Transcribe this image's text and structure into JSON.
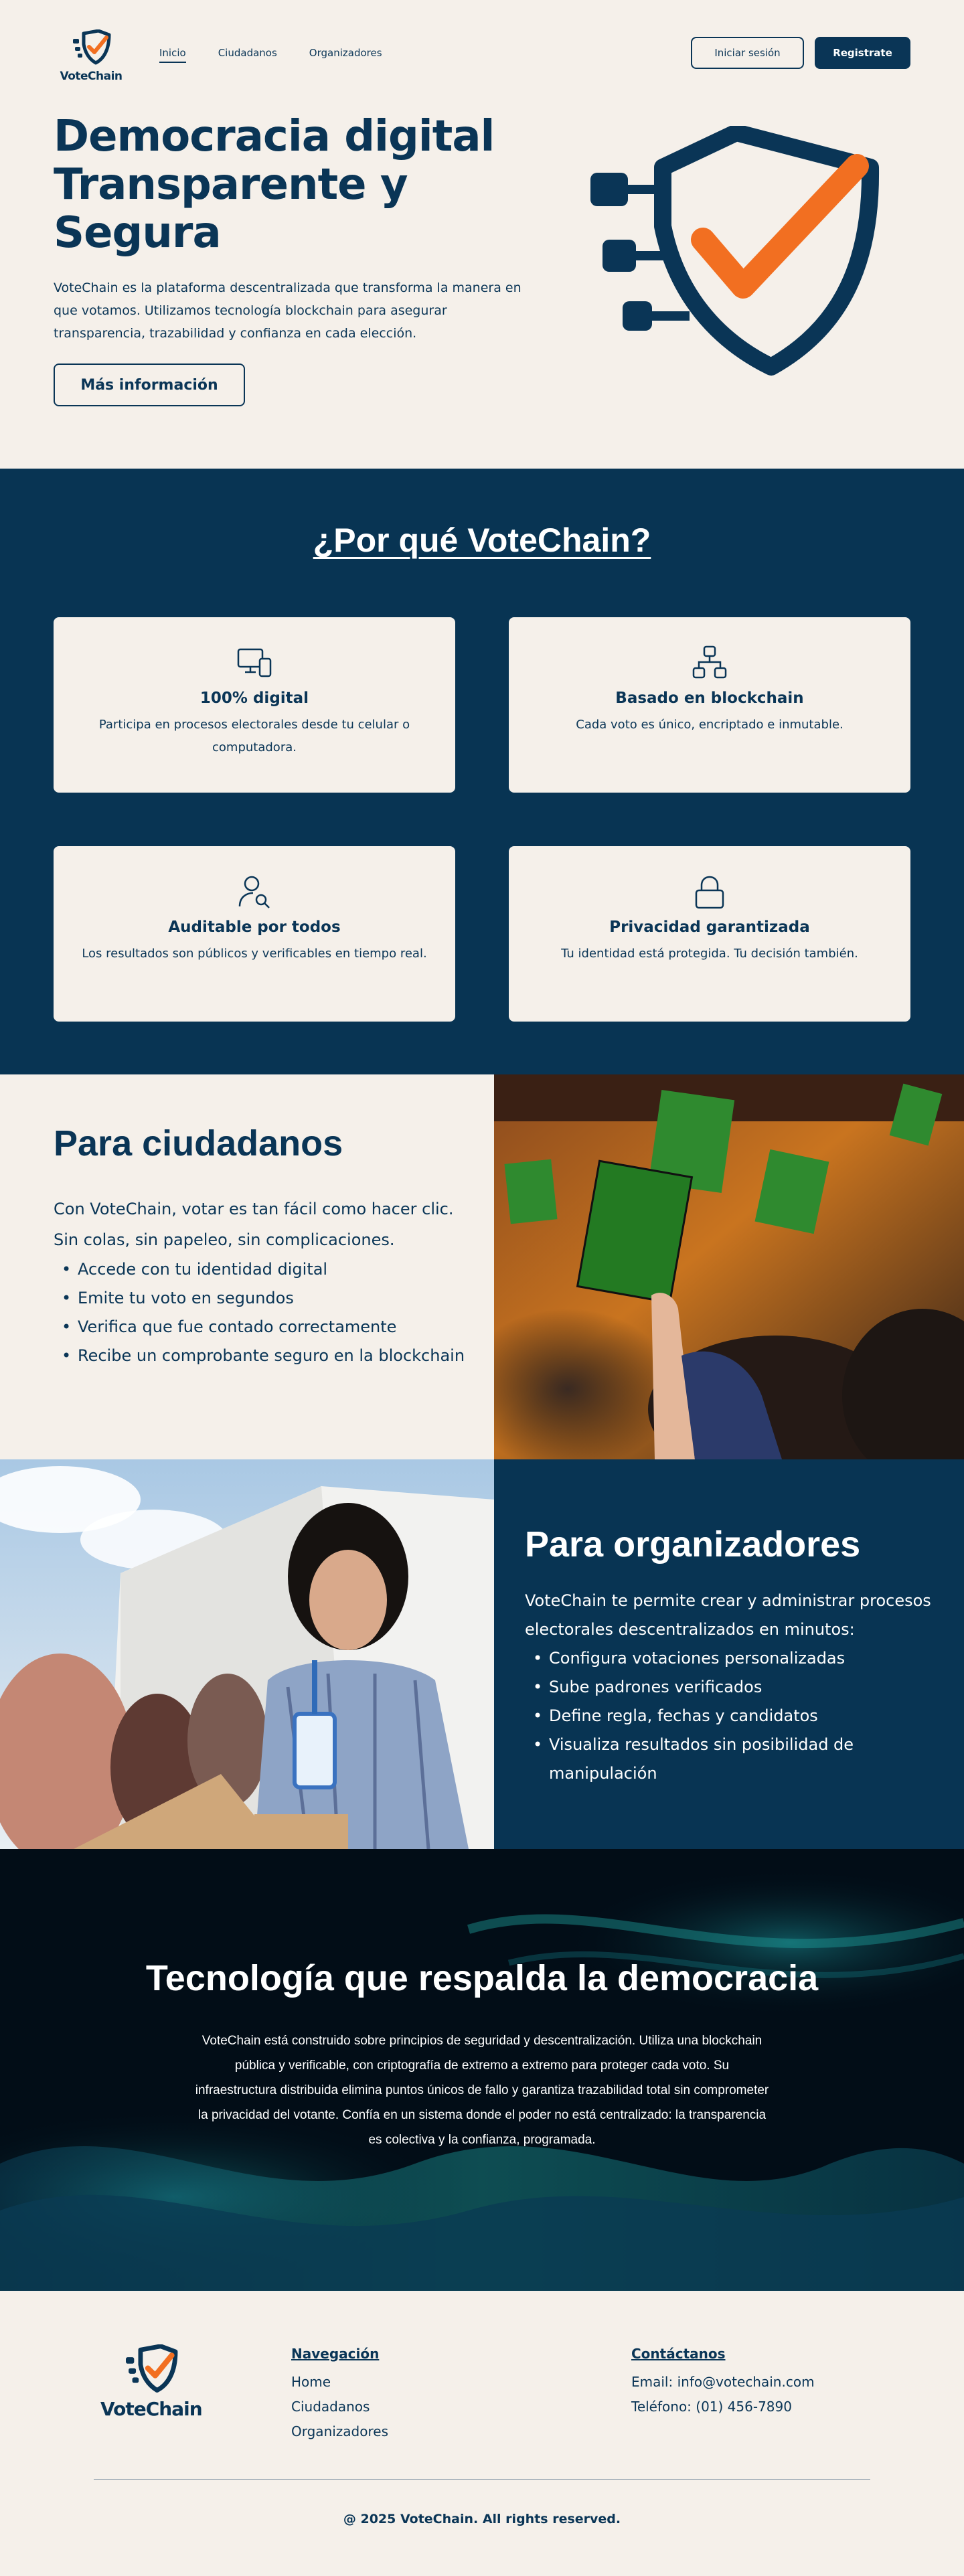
{
  "brand": {
    "name": "VoteChain",
    "colors": {
      "navy": "#0a3556",
      "orange": "#f26f21",
      "cream": "#f5f0ea"
    }
  },
  "nav": {
    "links": [
      "Inicio",
      "Ciudadanos",
      "Organizadores"
    ],
    "active": "Inicio",
    "login_label": "Iniciar sesión",
    "register_label": "Registrate"
  },
  "hero": {
    "title_line1": "Democracia digital",
    "title_line2": "Transparente y",
    "title_line3": "Segura",
    "description": "VoteChain es la plataforma descentralizada que transforma la manera en que votamos. Utilizamos tecnología blockchain para asegurar transparencia, trazabilidad y confianza en cada elección.",
    "cta_label": "Más información",
    "icon": "shield-check-icon"
  },
  "why": {
    "title": "¿Por qué VoteChain?",
    "cards": [
      {
        "icon": "devices-icon",
        "title": "100% digital",
        "description": "Participa en procesos electorales desde tu celular o computadora."
      },
      {
        "icon": "network-icon",
        "title": "Basado en blockchain",
        "description": "Cada voto es único, encriptado e inmutable."
      },
      {
        "icon": "user-search-icon",
        "title": "Auditable por todos",
        "description": "Los resultados son públicos y verificables en tiempo real."
      },
      {
        "icon": "lock-icon",
        "title": "Privacidad garantizada",
        "description": "Tu identidad está protegida. Tu decisión también."
      }
    ]
  },
  "citizens": {
    "title": "Para ciudadanos",
    "intro_line1": "Con VoteChain, votar es tan fácil como hacer clic.",
    "intro_line2": "Sin colas, sin papeleo, sin complicaciones.",
    "bullets": [
      "Accede con tu identidad digital",
      "Emite tu voto en segundos",
      "Verifica que fue contado correctamente",
      "Recibe un comprobante seguro en la blockchain"
    ]
  },
  "organizers": {
    "title": "Para organizadores",
    "intro": "VoteChain te permite crear y administrar procesos electorales descentralizados en minutos:",
    "bullets": [
      "Configura votaciones personalizadas",
      "Sube padrones verificados",
      "Define regla, fechas y candidatos",
      "Visualiza resultados sin posibilidad de manipulación"
    ]
  },
  "tech": {
    "title": "Tecnología que respalda la democracia",
    "description": "VoteChain está construido sobre principios de seguridad y descentralización. Utiliza una blockchain pública y verificable, con criptografía de extremo a extremo para proteger cada voto. Su infraestructura distribuida elimina puntos únicos de fallo y garantiza trazabilidad total sin comprometer la privacidad del votante. Confía en un sistema donde el poder no está centralizado: la transparencia es colectiva y la confianza, programada."
  },
  "footer": {
    "nav_title": "Navegación",
    "nav_links": [
      "Home",
      "Ciudadanos",
      "Organizadores"
    ],
    "contact_title": "Contáctanos",
    "email": "Email: info@votechain.com",
    "phone": "Teléfono: (01) 456-7890",
    "copyright": "@ 2025 VoteChain. All rights reserved."
  }
}
